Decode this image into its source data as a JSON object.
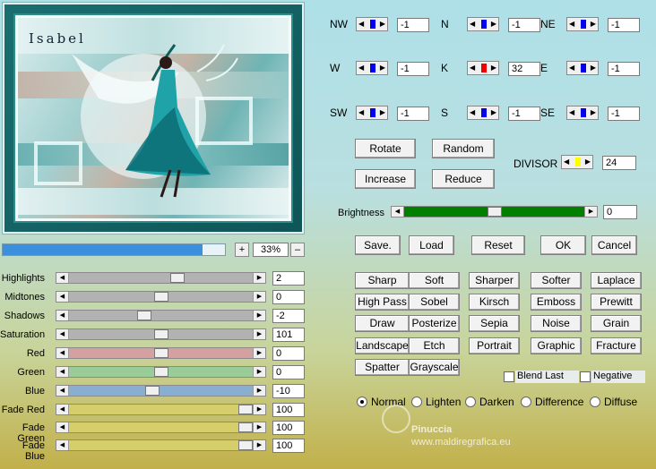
{
  "preview": {
    "logo": "Isabel"
  },
  "zoom": {
    "plus": "+",
    "minus": "–",
    "value": "33%",
    "progress": 0.9
  },
  "sliders": [
    {
      "label": "Highlights",
      "value": "2",
      "color": "#b2b2b2",
      "pos": 0.6
    },
    {
      "label": "Midtones",
      "value": "0",
      "color": "#b2b2b2",
      "pos": 0.5
    },
    {
      "label": "Shadows",
      "value": "-2",
      "color": "#b2b2b2",
      "pos": 0.4
    },
    {
      "label": "Saturation",
      "value": "101",
      "color": "#b2b2b2",
      "pos": 0.5
    },
    {
      "label": "Red",
      "value": "0",
      "color": "#d4a0a0",
      "pos": 0.5
    },
    {
      "label": "Green",
      "value": "0",
      "color": "#99cc99",
      "pos": 0.5
    },
    {
      "label": "Blue",
      "value": "-10",
      "color": "#88aed0",
      "pos": 0.45
    },
    {
      "label": "Fade Red",
      "value": "100",
      "color": "#d6ce6a",
      "pos": 1.0
    },
    {
      "label": "Fade Green",
      "value": "100",
      "color": "#d6ce6a",
      "pos": 1.0
    },
    {
      "label": "Fade Blue",
      "value": "100",
      "color": "#d6ce6a",
      "pos": 1.0
    }
  ],
  "kernel": [
    {
      "label": "NW",
      "value": "-1",
      "color": "#0000ee"
    },
    {
      "label": "N",
      "value": "-1",
      "color": "#0000ee"
    },
    {
      "label": "NE",
      "value": "-1",
      "color": "#0000ee"
    },
    {
      "label": "W",
      "value": "-1",
      "color": "#0000ee"
    },
    {
      "label": "K",
      "value": "32",
      "color": "#ee0000"
    },
    {
      "label": "E",
      "value": "-1",
      "color": "#0000ee"
    },
    {
      "label": "SW",
      "value": "-1",
      "color": "#0000ee"
    },
    {
      "label": "S",
      "value": "-1",
      "color": "#0000ee"
    },
    {
      "label": "SE",
      "value": "-1",
      "color": "#0000ee"
    }
  ],
  "divisor": {
    "label": "DIVISOR",
    "value": "24",
    "color": "#ffff00"
  },
  "kernel_buttons": [
    "Rotate",
    "Random",
    "Increase",
    "Reduce"
  ],
  "brightness": {
    "label": "Brightness",
    "value": "0",
    "level": 0.5,
    "color": "#008000"
  },
  "actions": [
    "Save.",
    "Load",
    "Reset",
    "OK",
    "Cancel"
  ],
  "filters": [
    "Sharp",
    "Soft",
    "Sharper",
    "Softer",
    "Laplace",
    "High Pass",
    "Sobel",
    "Kirsch",
    "Emboss",
    "Prewitt",
    "Draw",
    "Posterize",
    "Sepia",
    "Noise",
    "Grain",
    "Landscape",
    "Etch",
    "Portrait",
    "Graphic",
    "Fracture",
    "Spatter",
    "Grayscale"
  ],
  "checkboxes": [
    "Blend Last",
    "Negative"
  ],
  "modes": [
    "Normal",
    "Lighten",
    "Darken",
    "Difference",
    "Diffuse"
  ],
  "selected_mode": "Normal",
  "watermark": {
    "name": "Pinuccia",
    "site": "www.maldiregrafica.eu"
  }
}
